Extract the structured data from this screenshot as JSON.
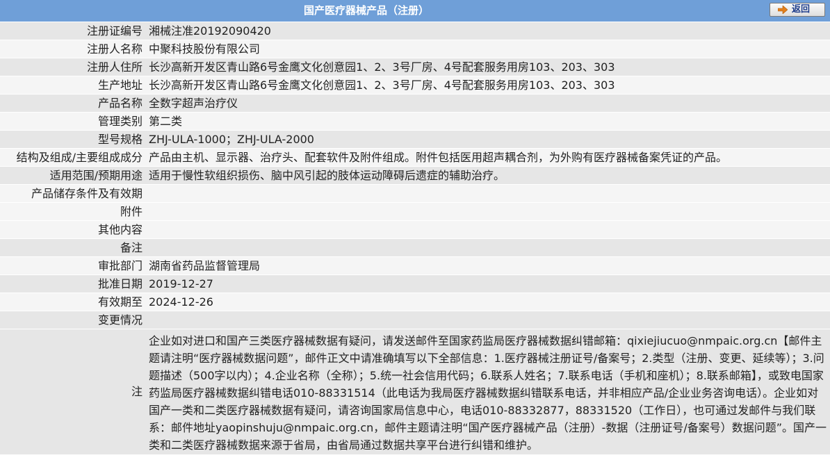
{
  "header": {
    "title": "国产医疗器械产品（注册）",
    "back_label": "返回",
    "back_icon": "arrow-right-icon",
    "colors": {
      "header_bg": "#6f9fd8",
      "arrow": "#e2801c",
      "back_text": "#1d3c8a"
    }
  },
  "fields": [
    {
      "label": "注册证编号",
      "value": "湘械注准20192090420"
    },
    {
      "label": "注册人名称",
      "value": "中聚科技股份有限公司"
    },
    {
      "label": "注册人住所",
      "value": "长沙高新开发区青山路6号金鹰文化创意园1、2、3号厂房、4号配套服务用房103、203、303"
    },
    {
      "label": "生产地址",
      "value": "长沙高新开发区青山路6号金鹰文化创意园1、2、3号厂房、4号配套服务用房103、203、303"
    },
    {
      "label": "产品名称",
      "value": "全数字超声治疗仪"
    },
    {
      "label": "管理类别",
      "value": "第二类"
    },
    {
      "label": "型号规格",
      "value": "ZHJ-ULA-1000；ZHJ-ULA-2000"
    },
    {
      "label": "结构及组成/主要组成成分",
      "value": "产品由主机、显示器、治疗头、配套软件及附件组成。附件包括医用超声耦合剂，为外购有医疗器械备案凭证的产品。"
    },
    {
      "label": "适用范围/预期用途",
      "value": "适用于慢性软组织损伤、脑中风引起的肢体运动障碍后遗症的辅助治疗。"
    },
    {
      "label": "产品储存条件及有效期",
      "value": ""
    },
    {
      "label": "附件",
      "value": ""
    },
    {
      "label": "其他内容",
      "value": ""
    },
    {
      "label": "备注",
      "value": ""
    },
    {
      "label": "审批部门",
      "value": "湖南省药品监督管理局"
    },
    {
      "label": "批准日期",
      "value": "2019-12-27"
    },
    {
      "label": "有效期至",
      "value": "2024-12-26"
    },
    {
      "label": "变更情况",
      "value": ""
    }
  ],
  "note": {
    "label": "注",
    "text": "企业如对进口和国产三类医疗器械数据有疑问，请发送邮件至国家药监局医疗器械数据纠错邮箱：qixiejiucuo@nmpaic.org.cn【邮件主题请注明“医疗器械数据问题”，邮件正文中请准确填写以下全部信息：1.医疗器械注册证号/备案号；2.类型（注册、变更、延续等）；3.问题描述（500字以内）；4.企业名称（全称）；5.统一社会信用代码；6.联系人姓名；7.联系电话（手机和座机）；8.联系邮箱】，或致电国家药监局医疗器械数据纠错电话010-88331514（此电话为我局医疗器械数据纠错联系电话，并非相应产品/企业业务咨询电话）。企业如对国产一类和二类医疗器械数据有疑问，请咨询国家局信息中心，电话010-88332877，88331520（工作日），也可通过发邮件与我们联系：邮件地址yaopinshuju@nmpaic.org.cn，邮件主题请注明“国产医疗器械产品（注册）-数据（注册证号/备案号）数据问题”。国产一类和二类医疗器械数据来源于省局，由省局通过数据共享平台进行纠错和维护。"
  }
}
